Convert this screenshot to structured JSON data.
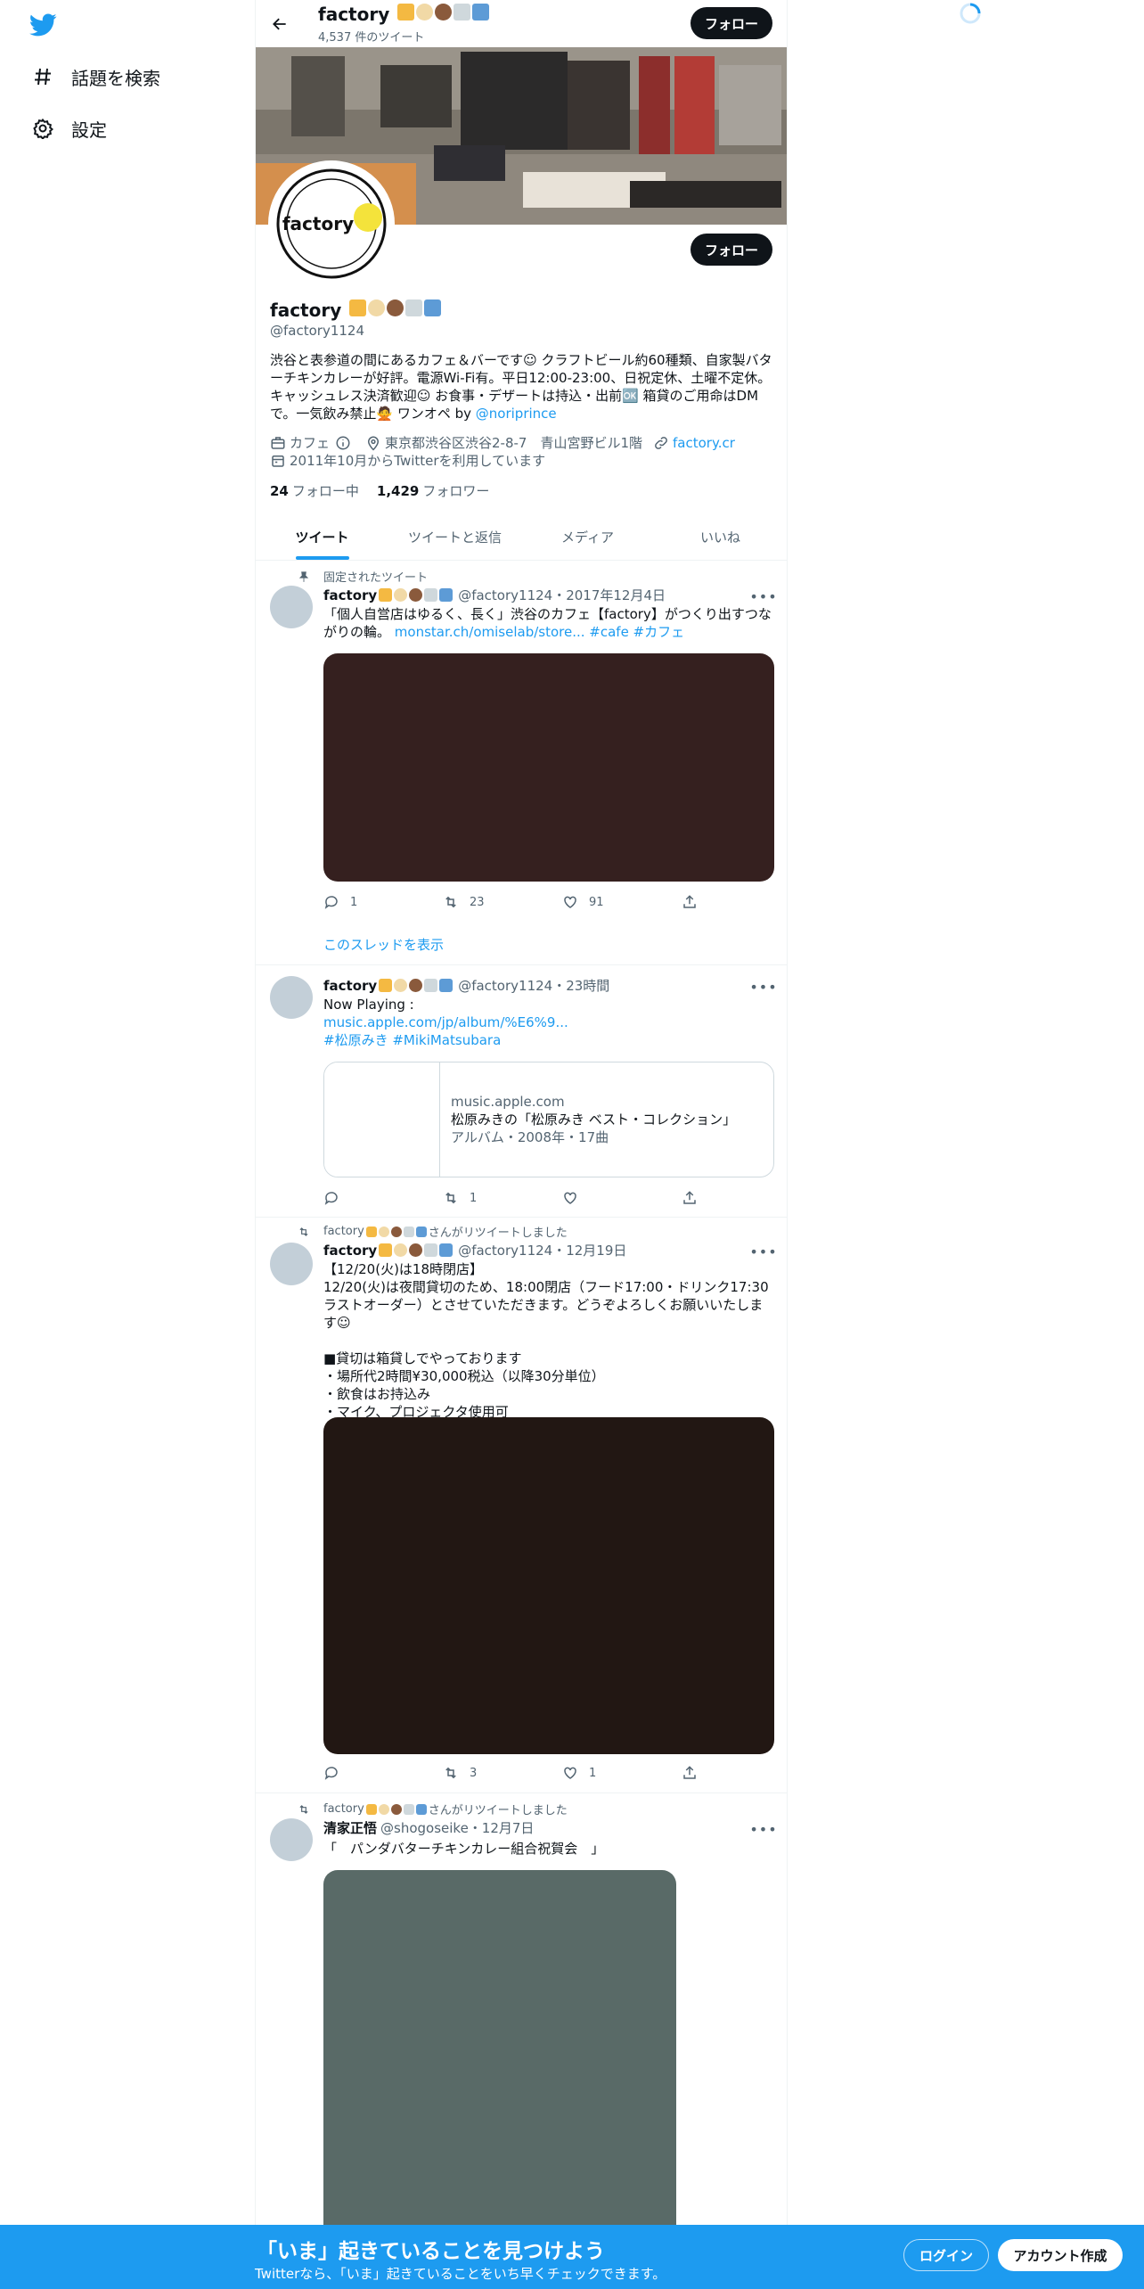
{
  "nav": {
    "explore_label": "話題を検索",
    "settings_label": "設定"
  },
  "profile": {
    "name": "factory",
    "tweet_count": "4,537 件のツイート",
    "follow_label": "フォロー",
    "handle": "@factory1124",
    "bio": "渋谷と表参道の間にあるカフェ＆バーです☺ クラフトビール約60種類、自家製バターチキンカレーが好評。電源Wi-Fi有。平日12:00-23:00、日祝定休、土曜不定休。キャッシュレス決済歓迎☺ お食事・デザートは持込・出前🆗 箱貸のご用命はDMで。一気飲み禁止🙅 ワンオペ by ",
    "bio_mention": "@noriprince",
    "category": "カフェ",
    "location": "東京都渋谷区渋谷2-8-7　青山宮野ビル1階",
    "website": "factory.cr",
    "joined": "2011年10月からTwitterを利用しています",
    "following_count": "24",
    "following_label": "フォロー中",
    "followers_count": "1,429",
    "followers_label": "フォロワー",
    "banner_logo_text": "factory"
  },
  "tabs": [
    "ツイート",
    "ツイートと返信",
    "メディア",
    "いいね"
  ],
  "tweets": [
    {
      "context": "固定されたツイート",
      "name": "factory",
      "handle_time": "@factory1124・2017年12月4日",
      "text": "「個人自営店はゆるく、長く」渋谷のカフェ【factory】がつくり出すつながりの輪。 ",
      "links": "monstar.ch/omiselab/store... #cafe #カフェ",
      "reply": "1",
      "retweet": "23",
      "like": "91",
      "show_thread": "このスレッドを表示",
      "media_color": "#35201f"
    },
    {
      "name": "factory",
      "handle_time": "@factory1124・23時間",
      "text_1": "Now Playing :",
      "link_1": "music.apple.com/jp/album/%E6%9...",
      "link_2": "#松原みき #MikiMatsubara",
      "card_domain": "music.apple.com",
      "card_title": "松原みきの「松原みき ベスト・コレクション」",
      "card_desc": "アルバム・2008年・17曲",
      "reply": "",
      "retweet": "1",
      "like": ""
    },
    {
      "context": "さんがリツイートしました",
      "context_name": "factory",
      "name": "factory",
      "handle_time": "@factory1124・12月19日",
      "text": "【12/20(火)は18時閉店】\n12/20(火)は夜間貸切のため、18:00閉店（フード17:00・ドリンク17:30ラストオーダー）とさせていただきます。どうぞよろしくお願いいたします☺\n\n■貸切は箱貸しでやっております\n・場所代2時間¥30,000税込（以降30分単位）\n・飲食はお持込み\n・マイク、プロジェクタ使用可",
      "reply": "",
      "retweet": "3",
      "like": "1",
      "media_color": "#221713"
    },
    {
      "context": "さんがリツイートしました",
      "context_name": "factory",
      "name": "清家正悟",
      "handle_time": "@shogoseike・12月7日",
      "text": "「　パンダバターチキンカレー組合祝賀会　」",
      "media_color": "#596a67"
    }
  ],
  "bottom": {
    "title": "「いま」起きていることを見つけよう",
    "subtitle": "Twitterなら、「いま」起きていることをいち早くチェックできます。",
    "login": "ログイン",
    "signup": "アカウント作成"
  },
  "colors": {
    "accent": "#1d9bf0",
    "text": "#0f1419",
    "muted": "#536471"
  }
}
